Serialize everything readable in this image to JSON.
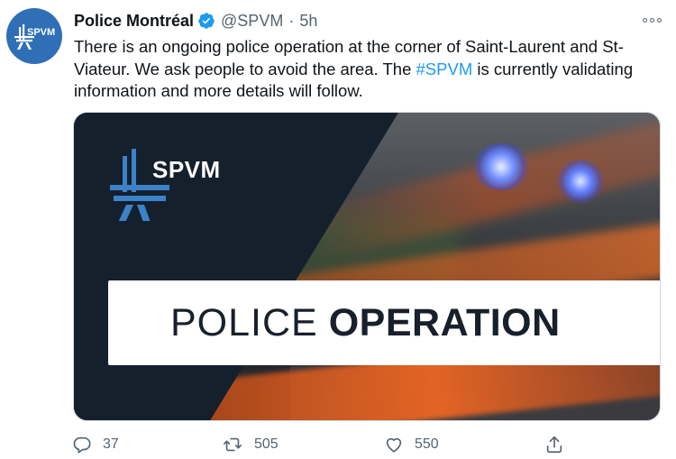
{
  "tweet": {
    "author_name": "Police Montréal",
    "handle": "@SPVM",
    "separator": "·",
    "time": "5h",
    "avatar_text": "SPVM",
    "text_before": "There is an ongoing police operation at the corner of Saint-Laurent and St-Viateur. We ask people to avoid the area. The ",
    "hashtag": "#SPVM",
    "text_after": " is currently validating information and more details will follow."
  },
  "media": {
    "logo_text": "SPVM",
    "banner_light": "POLICE",
    "banner_bold": "OPERATION"
  },
  "actions": {
    "replies": "37",
    "retweets": "505",
    "likes": "550"
  },
  "colors": {
    "avatar_bg": "#2f6fb6",
    "logo_blue": "#3b82c8",
    "hashtag": "#1d9bf0",
    "verified": "#1d9bf0",
    "navy_panel": "#15202d",
    "muted_text": "#536471"
  },
  "icons": [
    "verified-badge-icon",
    "more-options-icon",
    "reply-icon",
    "retweet-icon",
    "like-icon",
    "share-icon"
  ]
}
